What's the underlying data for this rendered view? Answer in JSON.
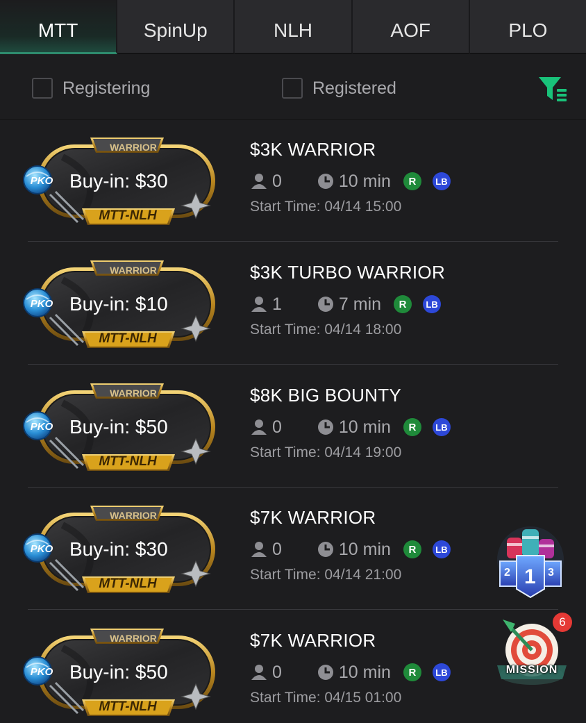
{
  "tabs": [
    {
      "label": "MTT",
      "active": true
    },
    {
      "label": "SpinUp",
      "active": false
    },
    {
      "label": "NLH",
      "active": false
    },
    {
      "label": "AOF",
      "active": false
    },
    {
      "label": "PLO",
      "active": false
    }
  ],
  "filters": {
    "registering": "Registering",
    "registered": "Registered",
    "icon": "filter-list-icon",
    "accent": "#19c27a"
  },
  "badge_common": {
    "top_label": "WARRIOR",
    "pko": "PKO",
    "bottom_label": "MTT-NLH"
  },
  "tournaments": [
    {
      "buyin": "Buy-in: $30",
      "title": "$3K WARRIOR",
      "players": "0",
      "duration": "10 min",
      "r": "R",
      "lb": "LB",
      "start": "Start Time: 04/14 15:00"
    },
    {
      "buyin": "Buy-in: $10",
      "title": "$3K TURBO WARRIOR",
      "players": "1",
      "duration": "7 min",
      "r": "R",
      "lb": "LB",
      "start": "Start Time: 04/14 18:00"
    },
    {
      "buyin": "Buy-in: $50",
      "title": "$8K BIG BOUNTY",
      "players": "0",
      "duration": "10 min",
      "r": "R",
      "lb": "LB",
      "start": "Start Time: 04/14 19:00"
    },
    {
      "buyin": "Buy-in: $30",
      "title": "$7K WARRIOR",
      "players": "0",
      "duration": "10 min",
      "r": "R",
      "lb": "LB",
      "start": "Start Time: 04/14 21:00"
    },
    {
      "buyin": "Buy-in: $50",
      "title": "$7K WARRIOR",
      "players": "0",
      "duration": "10 min",
      "r": "R",
      "lb": "LB",
      "start": "Start Time: 04/15 01:00"
    }
  ],
  "leaderboard_button": {
    "rank_left": "2",
    "rank_center": "1",
    "rank_right": "3"
  },
  "mission_button": {
    "label": "MISSION",
    "badge_count": "6"
  }
}
